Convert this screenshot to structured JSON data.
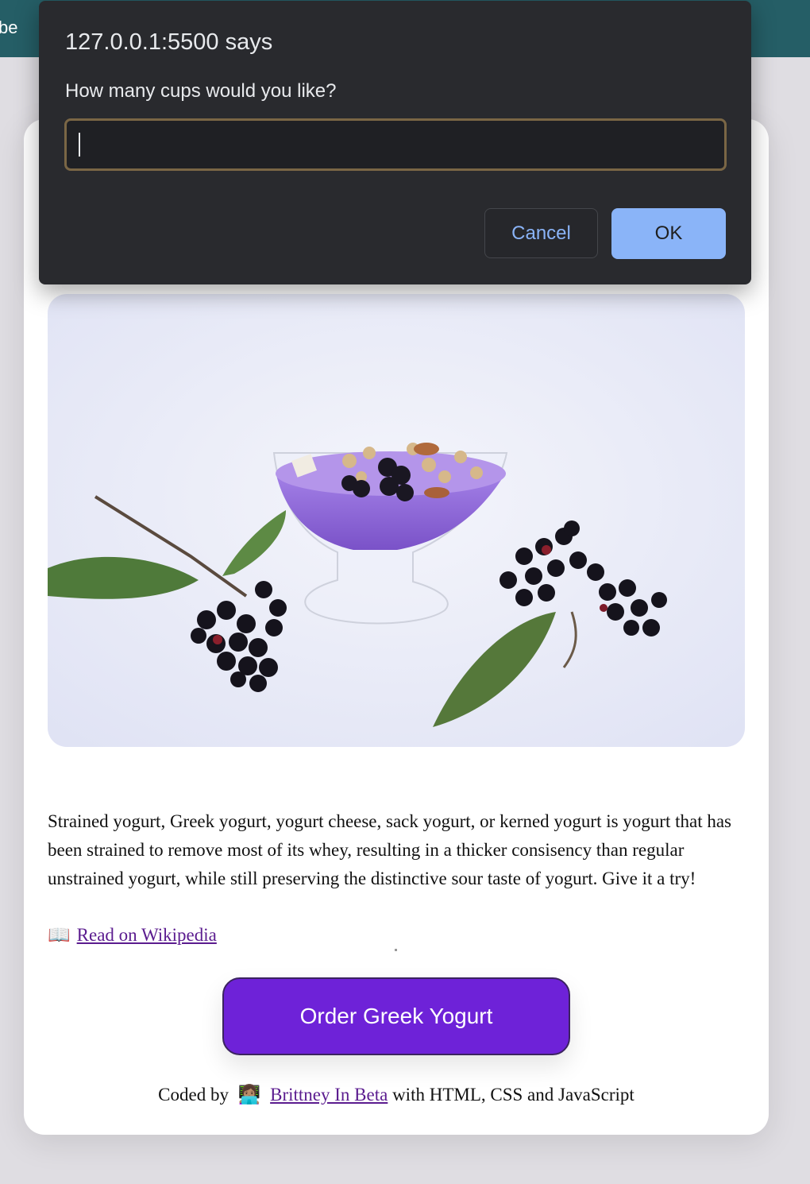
{
  "header": {
    "partial_text": "be"
  },
  "dialog": {
    "title": "127.0.0.1:5500 says",
    "message": "How many cups would you like?",
    "input_value": "",
    "cancel_label": "Cancel",
    "ok_label": "OK"
  },
  "card": {
    "description": "Strained yogurt, Greek yogurt, yogurt cheese, sack yogurt, or kerned yogurt is yogurt that has been strained to remove most of its whey, resulting in a thicker consisency than regular unstrained yogurt, while still preserving the distinctive sour taste of yogurt. Give it a try!",
    "wiki_icon": "📖",
    "wiki_link": "Read on Wikipedia",
    "order_button": "Order Greek Yogurt",
    "footer": {
      "prefix": "Coded by",
      "avatar": "👩🏽‍💻",
      "author_link": "Brittney In Beta",
      "suffix": "with HTML, CSS and JavaScript"
    }
  },
  "colors": {
    "header_bg": "#255e66",
    "button_bg": "#6e22d8",
    "dialog_bg": "#292a2e",
    "ok_bg": "#8ab4f8",
    "link": "#5b1c8f"
  }
}
